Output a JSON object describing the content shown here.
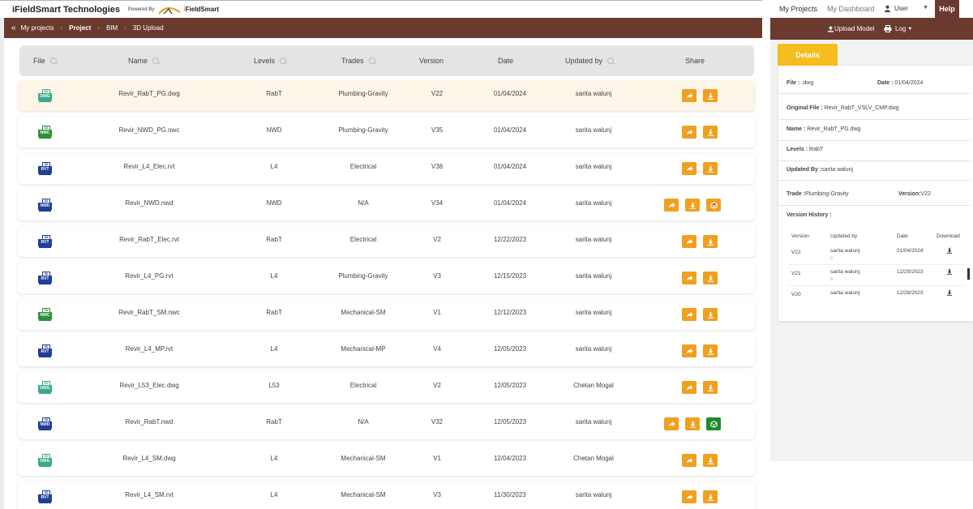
{
  "header": {
    "company": "iFieldSmart Technologies",
    "powered_by": "Powered By",
    "logo_prefix": "i",
    "logo_name": "FieldSmart"
  },
  "breadcrumb": {
    "items": [
      "My projects",
      "Project",
      "BIM",
      "3D Upload"
    ]
  },
  "table": {
    "columns": [
      "File",
      "Name",
      "Levels",
      "Trades",
      "Version",
      "Date",
      "Updated by",
      "Share"
    ],
    "rows": [
      {
        "type": "DWG",
        "name": "Revir_RabT_PG.dwg",
        "level": "RabT",
        "trade": "Plumbing-Gravity",
        "version": "V22",
        "date": "01/04/2024",
        "updated_by": "sarita walunj",
        "extra": ""
      },
      {
        "type": "NWC",
        "name": "Revir_NWD_PG.nwc",
        "level": "NWD",
        "trade": "Plumbing-Gravity",
        "version": "V35",
        "date": "01/04/2024",
        "updated_by": "sarita walunj",
        "extra": ""
      },
      {
        "type": "RVT",
        "name": "Revir_L4_Elec.rvt",
        "level": "L4",
        "trade": "Electrical",
        "version": "V38",
        "date": "01/04/2024",
        "updated_by": "sarita walunj",
        "extra": ""
      },
      {
        "type": "NWD",
        "name": "Revir_NWD.nwd",
        "level": "NWD",
        "trade": "N/A",
        "version": "V34",
        "date": "01/04/2024",
        "updated_by": "sarita walunj",
        "extra": "orange"
      },
      {
        "type": "RVT",
        "name": "Revir_RabT_Elec.rvt",
        "level": "RabT",
        "trade": "Electrical",
        "version": "V2",
        "date": "12/22/2023",
        "updated_by": "sarita walunj",
        "extra": ""
      },
      {
        "type": "RVT",
        "name": "Revir_L4_PG.rvt",
        "level": "L4",
        "trade": "Plumbing-Gravity",
        "version": "V3",
        "date": "12/15/2023",
        "updated_by": "sarita walunj",
        "extra": ""
      },
      {
        "type": "NWC",
        "name": "Revir_RabT_SM.nwc",
        "level": "RabT",
        "trade": "Mechanical-SM",
        "version": "V1",
        "date": "12/12/2023",
        "updated_by": "sarita walunj",
        "extra": ""
      },
      {
        "type": "RVT",
        "name": "Revir_L4_MP.rvt",
        "level": "L4",
        "trade": "Mechanical-MP",
        "version": "V4",
        "date": "12/05/2023",
        "updated_by": "sarita walunj",
        "extra": ""
      },
      {
        "type": "DWG",
        "name": "Revir_L53_Elec.dwg",
        "level": "L53",
        "trade": "Electrical",
        "version": "V2",
        "date": "12/05/2023",
        "updated_by": "Chetan Mogal",
        "extra": ""
      },
      {
        "type": "NWD",
        "name": "Revir_RabT.nwd",
        "level": "RabT",
        "trade": "N/A",
        "version": "V32",
        "date": "12/05/2023",
        "updated_by": "sarita walunj",
        "extra": "green"
      },
      {
        "type": "DWG",
        "name": "Revir_L4_SM.dwg",
        "level": "L4",
        "trade": "Mechanical-SM",
        "version": "V1",
        "date": "12/04/2023",
        "updated_by": "Chetan Mogal",
        "extra": ""
      },
      {
        "type": "RVT",
        "name": "Revir_L4_SM.rvt",
        "level": "L4",
        "trade": "Mechanical-SM",
        "version": "V3",
        "date": "11/30/2023",
        "updated_by": "sarita walunj",
        "extra": ""
      }
    ]
  },
  "file_icon": {
    "badge": "3D",
    "colors": {
      "DWG": "#3aaa8c",
      "NWC": "#2f8f3a",
      "RVT": "#1f3f95",
      "NWD": "#1f3f95"
    }
  },
  "topnav": {
    "my_projects": "My Projects",
    "my_dashboard": "My Dashboard",
    "user": "User",
    "help": "Help"
  },
  "toolbar": {
    "upload_model": "Upload Model",
    "log": "Log"
  },
  "details": {
    "tab": "Details",
    "file_label": "File :",
    "file_value": ".dwg",
    "date_label": "Date :",
    "date_value": "01/04/2024",
    "original_label": "Original File :",
    "original_value": "Revir_RabT_VSLV_CMP.dwg",
    "name_label": "Name :",
    "name_value": "Revir_RabT_PG.dwg",
    "levels_label": "Levels :",
    "levels_value": "RabT",
    "updated_label": "Updated By :",
    "updated_value": "sarita walunj",
    "trade_label": "Trade :",
    "trade_value": "Plumbing-Gravity",
    "version_label": "Version:",
    "version_value": "V22",
    "history_label": "Version History :",
    "history_columns": [
      "Version",
      "Updated by",
      "Date",
      "Download"
    ],
    "history": [
      {
        "version": "V22",
        "updated_by": "sarita walunj",
        "sub": "()",
        "date": "01/04/2024"
      },
      {
        "version": "V21",
        "updated_by": "sarita walunj",
        "sub": "()",
        "date": "12/29/2023"
      },
      {
        "version": "V20",
        "updated_by": "sarita walunj",
        "sub": "",
        "date": "12/28/2023"
      }
    ]
  },
  "colors": {
    "brand_brown": "#6b3a2e",
    "accent_orange": "#f0a020",
    "tab_yellow": "#f5bd1f",
    "green": "#1e8a2e"
  }
}
